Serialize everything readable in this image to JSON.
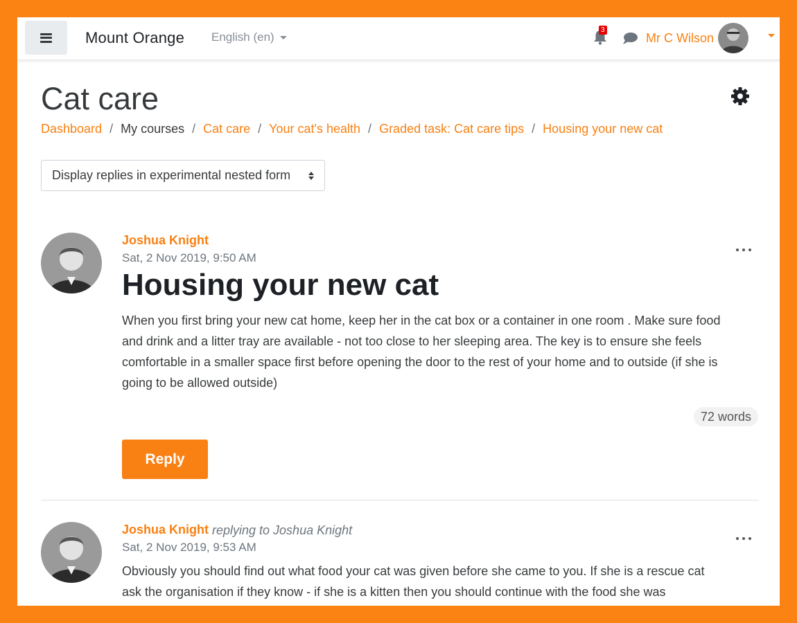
{
  "navbar": {
    "site_name": "Mount Orange",
    "language": "English (en)",
    "notification_count": "3",
    "user_name": "Mr C Wilson"
  },
  "page": {
    "title": "Cat care",
    "breadcrumb": {
      "dashboard": "Dashboard",
      "my_courses": "My courses",
      "course": "Cat care",
      "section": "Your cat's health",
      "activity": "Graded task: Cat care tips",
      "discussion": "Housing your new cat",
      "separator": "/"
    },
    "display_mode": "Display replies in experimental nested form"
  },
  "posts": [
    {
      "author": "Joshua Knight",
      "time": "Sat, 2 Nov 2019, 9:50 AM",
      "subject": "Housing your new cat",
      "body": "When you first bring your new cat home, keep her in the cat box or a container in one room . Make sure food and drink and a litter tray are available  - not too close to her sleeping area. The key is to ensure she feels comfortable in a smaller space first before opening the door to the rest of your home and to outside (if she is going to be allowed outside)",
      "word_count": "72 words",
      "reply_label": "Reply"
    },
    {
      "author": "Joshua Knight",
      "replying_to": "replying to Joshua Knight",
      "time": "Sat, 2 Nov 2019, 9:53 AM",
      "body": "Obviously you should find out what food your cat was given before she came to you. If she is a rescue cat ask the organisation if they know - if she is a kitten then you should continue with the food she was"
    }
  ],
  "colors": {
    "brand": "#f98012",
    "frame": "#fa8314",
    "badge": "#e60000"
  },
  "icons": {
    "menu": "hamburger-icon",
    "notifications": "bell-icon",
    "messages": "chat-bubble-icon",
    "settings": "gear-icon",
    "post_actions": "more-horizontal-icon"
  }
}
